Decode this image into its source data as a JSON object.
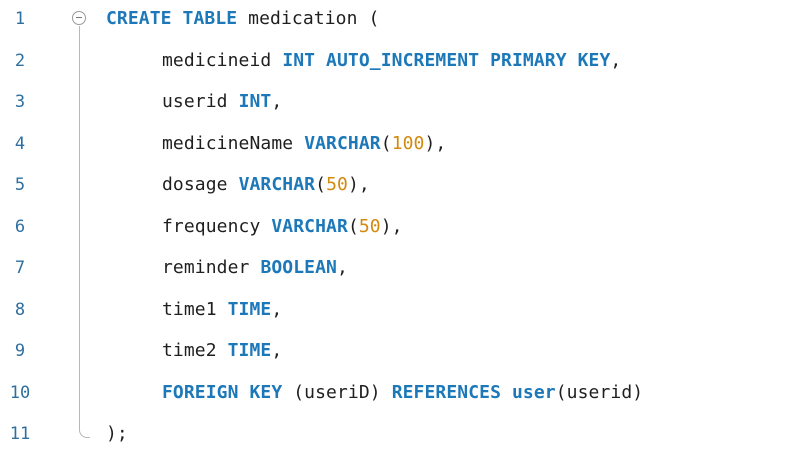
{
  "editor": {
    "line_numbers": [
      "1",
      "2",
      "3",
      "4",
      "5",
      "6",
      "7",
      "8",
      "9",
      "10",
      "11"
    ],
    "fold_icon": "collapse-circle-icon",
    "lines": [
      [
        {
          "text": "CREATE TABLE",
          "type": "keyword"
        },
        {
          "text": " medication (",
          "type": "ident"
        }
      ],
      [
        {
          "text": "medicineid ",
          "type": "ident"
        },
        {
          "text": "INT AUTO_INCREMENT PRIMARY KEY",
          "type": "keyword"
        },
        {
          "text": ",",
          "type": "punct"
        }
      ],
      [
        {
          "text": "userid ",
          "type": "ident"
        },
        {
          "text": "INT",
          "type": "keyword"
        },
        {
          "text": ",",
          "type": "punct"
        }
      ],
      [
        {
          "text": "medicineName ",
          "type": "ident"
        },
        {
          "text": "VARCHAR",
          "type": "keyword"
        },
        {
          "text": "(",
          "type": "punct"
        },
        {
          "text": "100",
          "type": "number"
        },
        {
          "text": "),",
          "type": "punct"
        }
      ],
      [
        {
          "text": "dosage ",
          "type": "ident"
        },
        {
          "text": "VARCHAR",
          "type": "keyword"
        },
        {
          "text": "(",
          "type": "punct"
        },
        {
          "text": "50",
          "type": "number"
        },
        {
          "text": "),",
          "type": "punct"
        }
      ],
      [
        {
          "text": "frequency ",
          "type": "ident"
        },
        {
          "text": "VARCHAR",
          "type": "keyword"
        },
        {
          "text": "(",
          "type": "punct"
        },
        {
          "text": "50",
          "type": "number"
        },
        {
          "text": "),",
          "type": "punct"
        }
      ],
      [
        {
          "text": "reminder ",
          "type": "ident"
        },
        {
          "text": "BOOLEAN",
          "type": "keyword"
        },
        {
          "text": ",",
          "type": "punct"
        }
      ],
      [
        {
          "text": "time1 ",
          "type": "ident"
        },
        {
          "text": "TIME",
          "type": "keyword"
        },
        {
          "text": ",",
          "type": "punct"
        }
      ],
      [
        {
          "text": "time2 ",
          "type": "ident"
        },
        {
          "text": "TIME",
          "type": "keyword"
        },
        {
          "text": ",",
          "type": "punct"
        }
      ],
      [
        {
          "text": "FOREIGN KEY",
          "type": "keyword"
        },
        {
          "text": " (useriD) ",
          "type": "ident"
        },
        {
          "text": "REFERENCES",
          "type": "keyword"
        },
        {
          "text": " ",
          "type": "ident"
        },
        {
          "text": "user",
          "type": "keyword"
        },
        {
          "text": "(userid)",
          "type": "ident"
        }
      ],
      [
        {
          "text": ");",
          "type": "punct"
        }
      ]
    ]
  }
}
